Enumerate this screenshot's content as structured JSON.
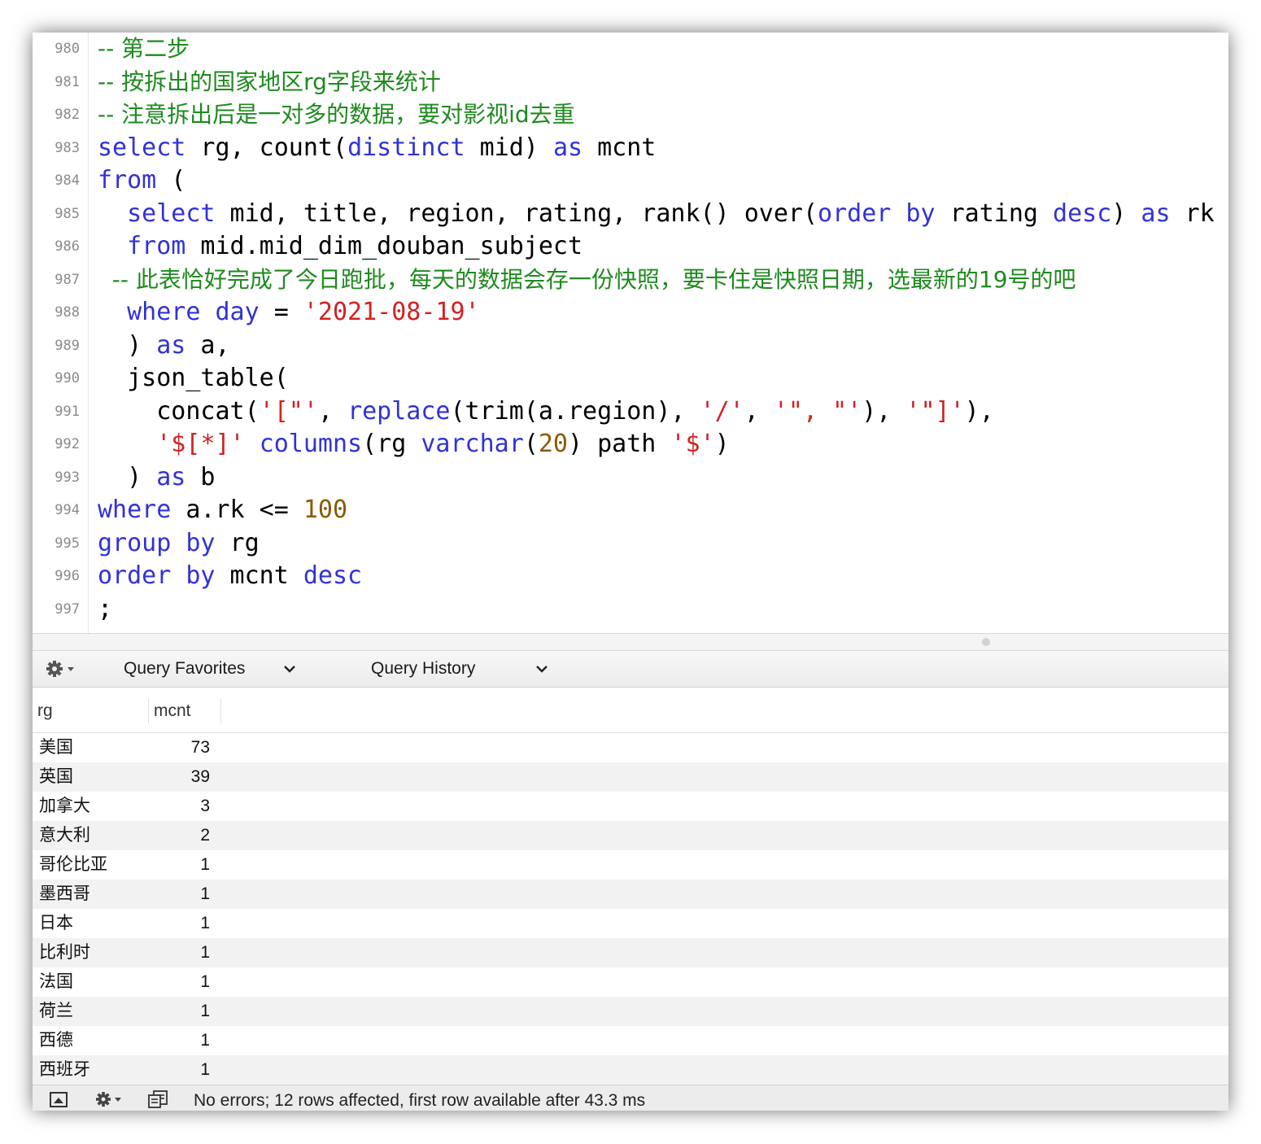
{
  "editor": {
    "lines": [
      {
        "num": "980",
        "tokens": [
          {
            "t": "-- 第二步",
            "c": "cmt"
          }
        ]
      },
      {
        "num": "981",
        "tokens": [
          {
            "t": "-- 按拆出的国家地区rg字段来统计",
            "c": "cmt"
          }
        ]
      },
      {
        "num": "982",
        "tokens": [
          {
            "t": "-- 注意拆出后是一对多的数据，要对影视id去重",
            "c": "cmt"
          }
        ]
      },
      {
        "num": "983",
        "tokens": [
          {
            "t": "select",
            "c": "kw"
          },
          {
            "t": " rg, count(",
            "c": "plain"
          },
          {
            "t": "distinct",
            "c": "kw"
          },
          {
            "t": " mid) ",
            "c": "plain"
          },
          {
            "t": "as",
            "c": "kw"
          },
          {
            "t": " mcnt",
            "c": "plain"
          }
        ]
      },
      {
        "num": "984",
        "tokens": [
          {
            "t": "from",
            "c": "kw"
          },
          {
            "t": " (",
            "c": "plain"
          }
        ]
      },
      {
        "num": "985",
        "tokens": [
          {
            "t": "  ",
            "c": "plain"
          },
          {
            "t": "select",
            "c": "kw"
          },
          {
            "t": " mid, title, region, rating, rank() over(",
            "c": "plain"
          },
          {
            "t": "order by",
            "c": "kw"
          },
          {
            "t": " rating ",
            "c": "plain"
          },
          {
            "t": "desc",
            "c": "kw"
          },
          {
            "t": ") ",
            "c": "plain"
          },
          {
            "t": "as",
            "c": "kw"
          },
          {
            "t": " rk",
            "c": "plain"
          }
        ]
      },
      {
        "num": "986",
        "tokens": [
          {
            "t": "  ",
            "c": "plain"
          },
          {
            "t": "from",
            "c": "kw"
          },
          {
            "t": " mid.mid_dim_douban_subject",
            "c": "plain"
          }
        ]
      },
      {
        "num": "987",
        "tokens": [
          {
            "t": "  -- 此表恰好完成了今日跑批，每天的数据会存一份快照，要卡住是快照日期，选最新的19号的吧",
            "c": "cmt"
          }
        ]
      },
      {
        "num": "988",
        "tokens": [
          {
            "t": "  ",
            "c": "plain"
          },
          {
            "t": "where",
            "c": "kw"
          },
          {
            "t": " ",
            "c": "plain"
          },
          {
            "t": "day",
            "c": "kw"
          },
          {
            "t": " = ",
            "c": "plain"
          },
          {
            "t": "'2021-08-19'",
            "c": "str"
          }
        ]
      },
      {
        "num": "989",
        "tokens": [
          {
            "t": "  ) ",
            "c": "plain"
          },
          {
            "t": "as",
            "c": "kw"
          },
          {
            "t": " a,",
            "c": "plain"
          }
        ]
      },
      {
        "num": "990",
        "tokens": [
          {
            "t": "  json_table(",
            "c": "plain"
          }
        ]
      },
      {
        "num": "991",
        "tokens": [
          {
            "t": "    concat(",
            "c": "plain"
          },
          {
            "t": "'[\"'",
            "c": "str"
          },
          {
            "t": ", ",
            "c": "plain"
          },
          {
            "t": "replace",
            "c": "kw"
          },
          {
            "t": "(trim(a.region), ",
            "c": "plain"
          },
          {
            "t": "'/'",
            "c": "str"
          },
          {
            "t": ", ",
            "c": "plain"
          },
          {
            "t": "'\", \"'",
            "c": "str"
          },
          {
            "t": "), ",
            "c": "plain"
          },
          {
            "t": "'\"]'",
            "c": "str"
          },
          {
            "t": "),",
            "c": "plain"
          }
        ]
      },
      {
        "num": "992",
        "tokens": [
          {
            "t": "    ",
            "c": "plain"
          },
          {
            "t": "'$[*]'",
            "c": "str"
          },
          {
            "t": " ",
            "c": "plain"
          },
          {
            "t": "columns",
            "c": "kw"
          },
          {
            "t": "(rg ",
            "c": "plain"
          },
          {
            "t": "varchar",
            "c": "kw"
          },
          {
            "t": "(",
            "c": "plain"
          },
          {
            "t": "20",
            "c": "num"
          },
          {
            "t": ") path ",
            "c": "plain"
          },
          {
            "t": "'$'",
            "c": "str"
          },
          {
            "t": ")",
            "c": "plain"
          }
        ]
      },
      {
        "num": "993",
        "tokens": [
          {
            "t": "  ) ",
            "c": "plain"
          },
          {
            "t": "as",
            "c": "kw"
          },
          {
            "t": " b",
            "c": "plain"
          }
        ]
      },
      {
        "num": "994",
        "tokens": [
          {
            "t": "where",
            "c": "kw"
          },
          {
            "t": " a.rk <= ",
            "c": "plain"
          },
          {
            "t": "100",
            "c": "num"
          }
        ]
      },
      {
        "num": "995",
        "tokens": [
          {
            "t": "group by",
            "c": "kw"
          },
          {
            "t": " rg",
            "c": "plain"
          }
        ]
      },
      {
        "num": "996",
        "tokens": [
          {
            "t": "order by",
            "c": "kw"
          },
          {
            "t": " mcnt ",
            "c": "plain"
          },
          {
            "t": "desc",
            "c": "kw"
          }
        ]
      },
      {
        "num": "997",
        "tokens": [
          {
            "t": ";",
            "c": "plain"
          }
        ]
      }
    ]
  },
  "query_bar": {
    "settings_icon": "gear-icon",
    "favorites_label": "Query Favorites",
    "history_label": "Query History"
  },
  "results": {
    "columns": [
      "rg",
      "mcnt"
    ],
    "rows": [
      [
        "美国",
        "73"
      ],
      [
        "英国",
        "39"
      ],
      [
        "加拿大",
        "3"
      ],
      [
        "意大利",
        "2"
      ],
      [
        "哥伦比亚",
        "1"
      ],
      [
        "墨西哥",
        "1"
      ],
      [
        "日本",
        "1"
      ],
      [
        "比利时",
        "1"
      ],
      [
        "法国",
        "1"
      ],
      [
        "荷兰",
        "1"
      ],
      [
        "西德",
        "1"
      ],
      [
        "西班牙",
        "1"
      ]
    ]
  },
  "status": {
    "message": "No errors; 12 rows affected, first row available after 43.3 ms",
    "icons": [
      "toggle-panel-icon",
      "gear-icon",
      "copy-results-icon"
    ]
  },
  "colors": {
    "keyword": "#3232d6",
    "string": "#d22222",
    "number": "#8b5a00",
    "comment": "#1e8a1e",
    "row_alt": "#f2f2f2"
  }
}
